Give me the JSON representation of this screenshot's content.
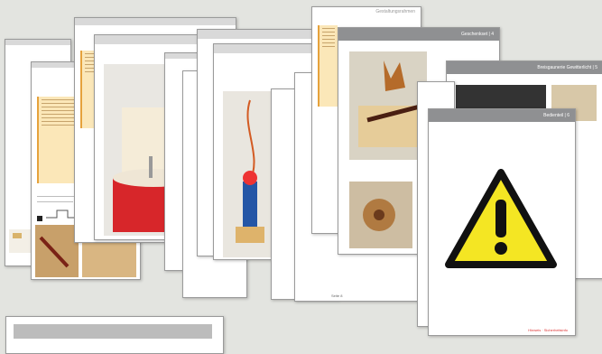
{
  "pages": {
    "gear_header": "Geschenkset | 4",
    "symbol_header": "Breisgaunerie Gewitterlicht | 5",
    "warning_header": "Bedienteil | 6",
    "warning_footer": "Hinweis · Sicherheitsinfo",
    "center_footer": "Seite 8",
    "top_right_header": "Gestaltungsrahmen"
  },
  "colors": {
    "warning_yellow": "#f4e623",
    "header_gray": "#8f9092",
    "note_orange": "#fbe7b8",
    "drum_red": "#d7262a"
  },
  "icons": [
    "warning-triangle-icon"
  ]
}
